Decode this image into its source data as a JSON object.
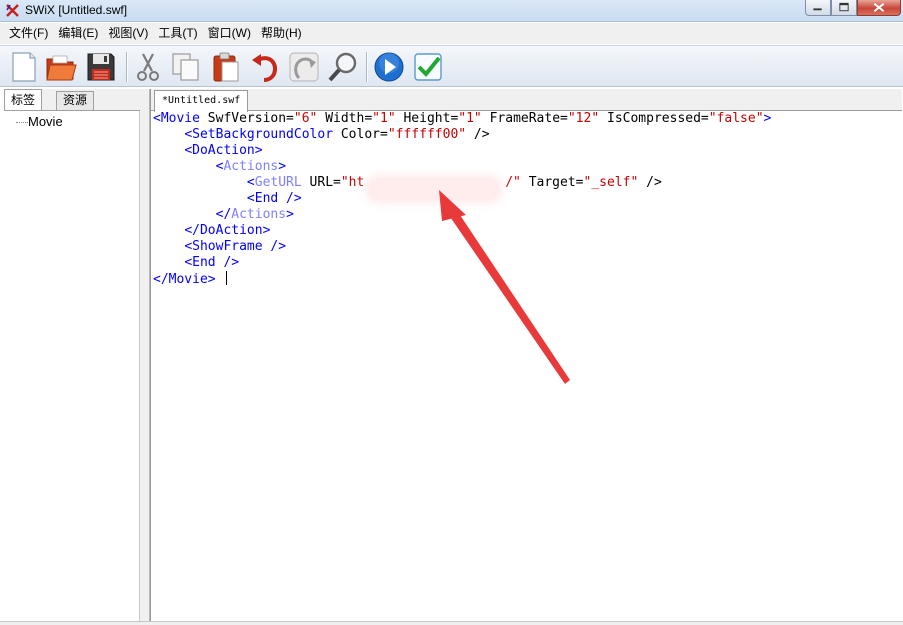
{
  "window": {
    "title": "SWiX [Untitled.swf]",
    "controls": {
      "minimize": "minimize-icon",
      "maximize": "maximize-icon",
      "close": "close-icon"
    }
  },
  "menu": [
    "文件(F)",
    "编辑(E)",
    "视图(V)",
    "工具(T)",
    "窗口(W)",
    "帮助(H)"
  ],
  "toolbar": {
    "buttons": [
      "new-file-icon",
      "open-folder-icon",
      "save-icon",
      "cut-icon",
      "copy-icon",
      "paste-icon",
      "undo-icon",
      "redo-icon",
      "find-icon",
      "play-icon",
      "validate-icon"
    ]
  },
  "left_panel": {
    "tabs": [
      "标签",
      "资源"
    ],
    "active_tab": "标签",
    "tree": [
      {
        "label": "Movie"
      }
    ]
  },
  "editor": {
    "tab_label": "*Untitled.swf",
    "lines": [
      [
        {
          "t": "tag",
          "v": "<"
        },
        {
          "t": "tag",
          "v": "Movie"
        },
        {
          "t": "at",
          "v": " SwfVersion="
        },
        {
          "t": "vl",
          "v": "\"6\""
        },
        {
          "t": "at",
          "v": " Width="
        },
        {
          "t": "vl",
          "v": "\"1\""
        },
        {
          "t": "at",
          "v": " Height="
        },
        {
          "t": "vl",
          "v": "\"1\""
        },
        {
          "t": "at",
          "v": " FrameRate="
        },
        {
          "t": "vl",
          "v": "\"12\""
        },
        {
          "t": "at",
          "v": " IsCompressed="
        },
        {
          "t": "vl",
          "v": "\"false\""
        },
        {
          "t": "tag",
          "v": ">"
        }
      ],
      [
        {
          "t": "nm",
          "v": "    "
        },
        {
          "t": "tag",
          "v": "<SetBackgroundColor"
        },
        {
          "t": "at",
          "v": " Color="
        },
        {
          "t": "vl",
          "v": "\"ffffff00\""
        },
        {
          "t": "at",
          "v": " />"
        }
      ],
      [
        {
          "t": "nm",
          "v": "    "
        },
        {
          "t": "tag",
          "v": "<DoAction>"
        }
      ],
      [
        {
          "t": "nm",
          "v": "        "
        },
        {
          "t": "tag",
          "v": "<"
        },
        {
          "t": "kw",
          "v": "Actions"
        },
        {
          "t": "tag",
          "v": ">"
        }
      ],
      [
        {
          "t": "nm",
          "v": "            "
        },
        {
          "t": "tag",
          "v": "<"
        },
        {
          "t": "kw",
          "v": "GetURL"
        },
        {
          "t": "at",
          "v": " URL="
        },
        {
          "t": "vl",
          "v": "\"ht                  /\""
        },
        {
          "t": "at",
          "v": " Target="
        },
        {
          "t": "vl",
          "v": "\"_self\""
        },
        {
          "t": "at",
          "v": " />"
        }
      ],
      [
        {
          "t": "nm",
          "v": "            "
        },
        {
          "t": "tag",
          "v": "<End />"
        }
      ],
      [
        {
          "t": "nm",
          "v": "        "
        },
        {
          "t": "tag",
          "v": "</"
        },
        {
          "t": "kw",
          "v": "Actions"
        },
        {
          "t": "tag",
          "v": ">"
        }
      ],
      [
        {
          "t": "nm",
          "v": "    "
        },
        {
          "t": "tag",
          "v": "</DoAction>"
        }
      ],
      [
        {
          "t": "nm",
          "v": "    "
        },
        {
          "t": "tag",
          "v": "<ShowFrame />"
        }
      ],
      [
        {
          "t": "nm",
          "v": "    "
        },
        {
          "t": "tag",
          "v": "<End />"
        }
      ],
      [
        {
          "t": "tag",
          "v": "</Movie>"
        },
        {
          "t": "nm",
          "v": " "
        }
      ]
    ],
    "redacted_region": "url-redaction",
    "annotation": "red-arrow"
  },
  "colors": {
    "tag": "#0000ff",
    "value": "#cc0000",
    "keyword": "#8080ff",
    "arrow": "#e83a3a"
  }
}
